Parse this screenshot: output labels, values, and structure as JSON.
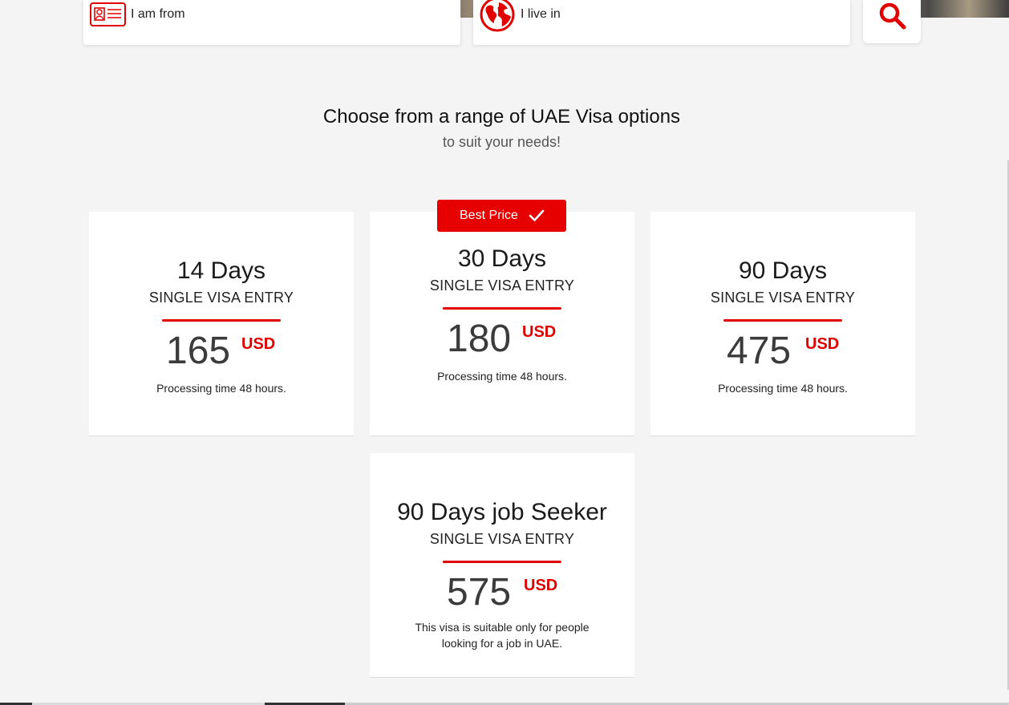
{
  "search": {
    "from_label": "I am from",
    "live_label": "I live in"
  },
  "heading": {
    "title": "Choose from a range of UAE Visa options",
    "subtitle": "to suit your needs!"
  },
  "badge": {
    "label": "Best Price"
  },
  "cards": [
    {
      "title": "14 Days",
      "entry": "SINGLE VISA ENTRY",
      "price": "165",
      "currency": "USD",
      "note": "Processing time 48 hours."
    },
    {
      "title": "30 Days",
      "entry": "SINGLE VISA ENTRY",
      "price": "180",
      "currency": "USD",
      "note": "Processing time 48 hours."
    },
    {
      "title": "90 Days",
      "entry": "SINGLE VISA ENTRY",
      "price": "475",
      "currency": "USD",
      "note": "Processing time 48 hours."
    },
    {
      "title": "90 Days job Seeker",
      "entry": "SINGLE VISA ENTRY",
      "price": "575",
      "currency": "USD",
      "note_line1": "This visa is suitable only for people",
      "note_line2": "looking for a job in UAE."
    }
  ],
  "colors": {
    "accent": "#e60000",
    "background": "#f4f4f4",
    "card": "#ffffff"
  },
  "icons": [
    "id-card-icon",
    "globe-icon",
    "search-icon",
    "checkmark-icon"
  ]
}
